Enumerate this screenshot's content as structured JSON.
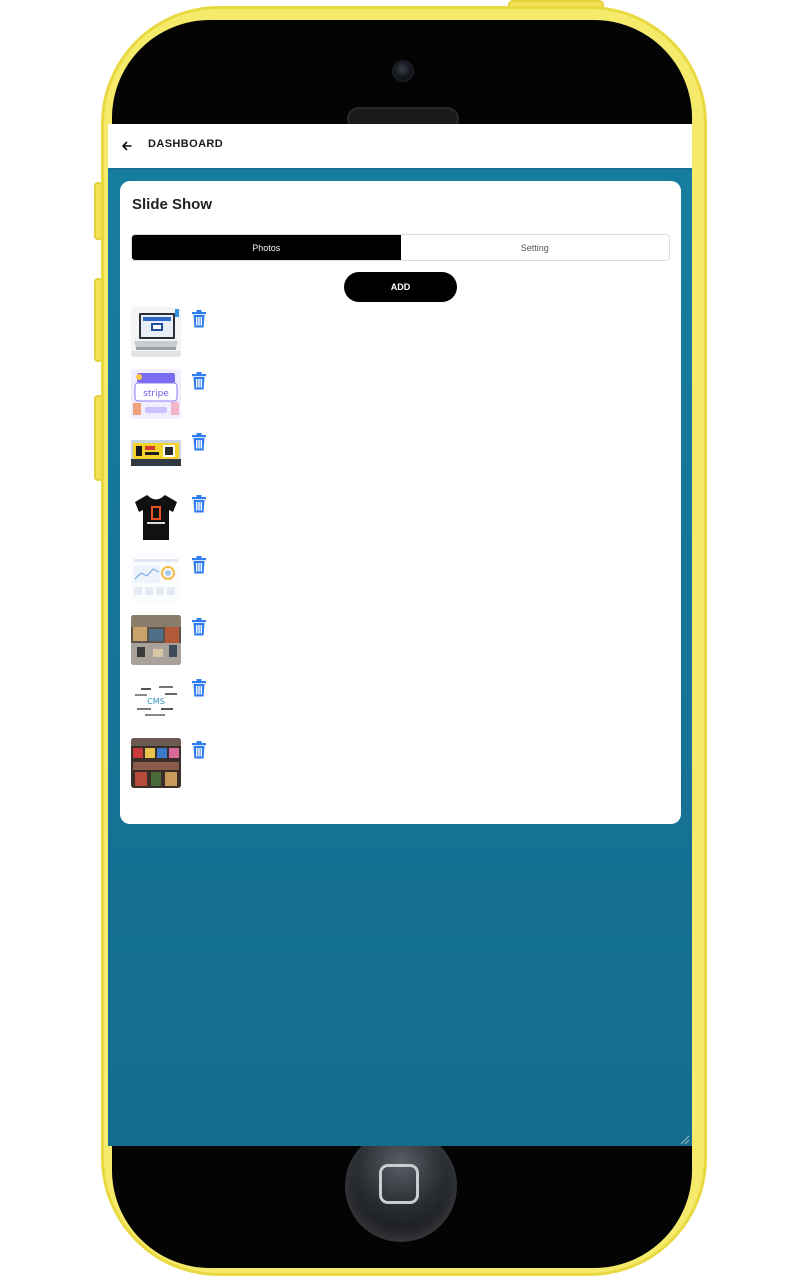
{
  "header": {
    "back_icon": "arrow-left-icon",
    "title": "DASHBOARD"
  },
  "card": {
    "title": "Slide Show",
    "tabs": [
      {
        "label": "Photos",
        "active": true
      },
      {
        "label": "Setting",
        "active": false
      }
    ],
    "add_label": "ADD"
  },
  "photos": [
    {
      "thumbnail": "laptop-image",
      "delete_icon": "trash-icon"
    },
    {
      "thumbnail": "stripe-illustration",
      "delete_icon": "trash-icon"
    },
    {
      "thumbnail": "billboard-image",
      "delete_icon": "trash-icon"
    },
    {
      "thumbnail": "tshirt-image",
      "delete_icon": "trash-icon"
    },
    {
      "thumbnail": "dashboard-chart-image",
      "delete_icon": "trash-icon"
    },
    {
      "thumbnail": "store-interior-image",
      "delete_icon": "trash-icon"
    },
    {
      "thumbnail": "cms-wordcloud-image",
      "delete_icon": "trash-icon"
    },
    {
      "thumbnail": "market-shop-image",
      "delete_icon": "trash-icon"
    }
  ],
  "colors": {
    "screen_bg": "#177e9f",
    "trash_icon": "#2f7bf0",
    "phone_body": "#f6ea6b",
    "tab_active": "#000000"
  }
}
